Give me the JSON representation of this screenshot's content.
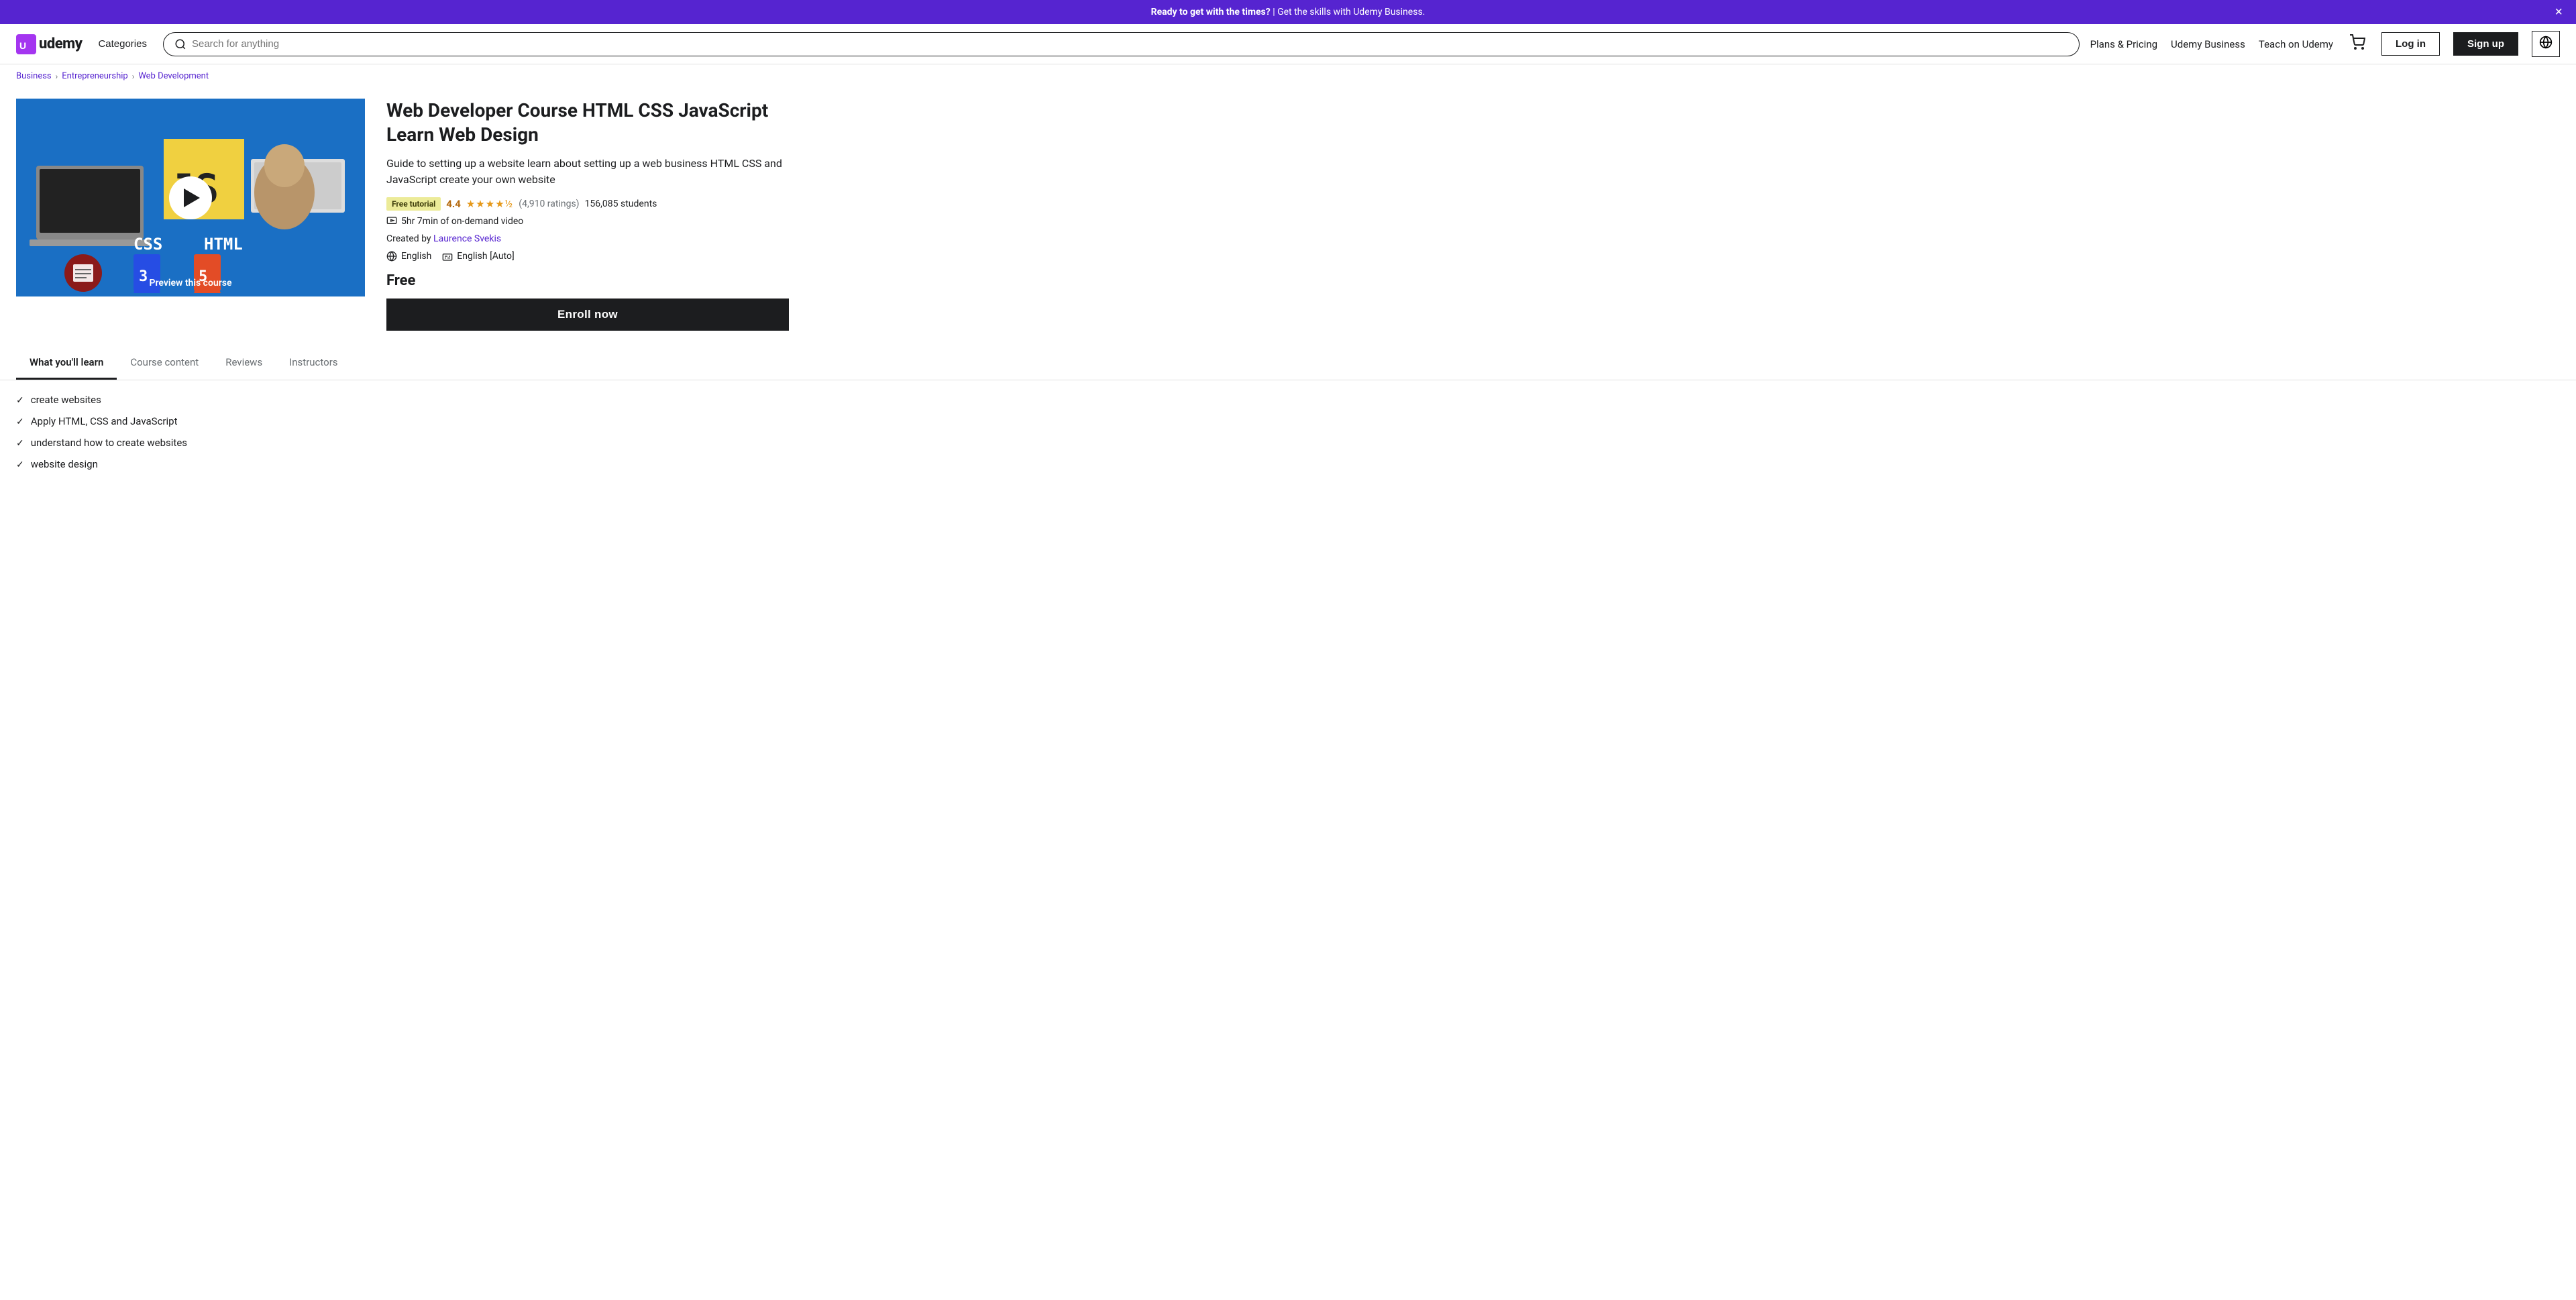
{
  "banner": {
    "text_bold": "Ready to get with the times?",
    "text_normal": " | Get the skills with Udemy Business.",
    "close_label": "×"
  },
  "navbar": {
    "logo_text": "udemy",
    "categories_label": "Categories",
    "search_placeholder": "Search for anything",
    "plans_pricing": "Plans & Pricing",
    "udemy_business": "Udemy Business",
    "teach_on_udemy": "Teach on Udemy",
    "login_label": "Log in",
    "signup_label": "Sign up"
  },
  "breadcrumb": {
    "items": [
      "Business",
      "Entrepreneurship",
      "Web Development"
    ]
  },
  "course": {
    "title": "Web Developer Course HTML CSS JavaScript Learn Web Design",
    "description": "Guide to setting up a website learn about setting up a web business HTML CSS and JavaScript create your own website",
    "free_badge": "Free tutorial",
    "rating_score": "4.4",
    "stars": "★★★★½",
    "rating_count": "(4,910 ratings)",
    "student_count": "156,085 students",
    "video_duration": "5hr 7min of on-demand video",
    "created_by_label": "Created by",
    "instructor": "Laurence Svekis",
    "language": "English",
    "captions": "English [Auto]",
    "price": "Free",
    "enroll_label": "Enroll now",
    "preview_label": "Preview this course"
  },
  "tabs": [
    {
      "label": "What you'll learn",
      "active": true
    },
    {
      "label": "Course content",
      "active": false
    },
    {
      "label": "Reviews",
      "active": false
    },
    {
      "label": "Instructors",
      "active": false
    }
  ],
  "learn_items": [
    "create websites",
    "Apply HTML, CSS and JavaScript",
    "understand how to create websites",
    "website design"
  ]
}
